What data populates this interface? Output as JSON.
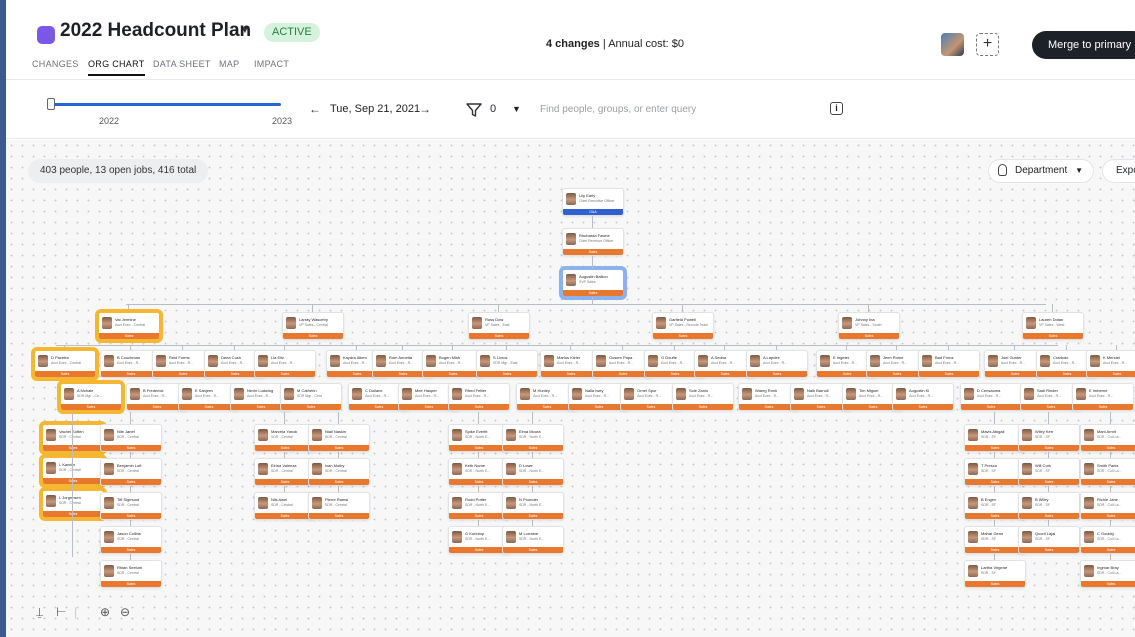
{
  "app": {
    "title": "2022 Headcount Plan",
    "status_badge": "ACTIVE",
    "changes_count": "4 changes",
    "annual_cost_label": "Annual cost: $0",
    "merge_label": "Merge to primary",
    "add_label": "+"
  },
  "tabs": [
    {
      "label": "CHANGES",
      "active": false
    },
    {
      "label": "ORG CHART",
      "active": true
    },
    {
      "label": "DATA SHEET",
      "active": false
    },
    {
      "label": "MAP",
      "active": false
    },
    {
      "label": "IMPACT",
      "active": false
    }
  ],
  "timeline": {
    "start_label": "2022",
    "end_label": "2023",
    "position": 0
  },
  "date_nav": {
    "current_date": "Tue, Sep 21, 2021",
    "prev": "←",
    "next": "→"
  },
  "filter": {
    "count": "0"
  },
  "search": {
    "placeholder": "Find people, groups, or enter query"
  },
  "info_label": "i",
  "canvas": {
    "people_summary": "403 people, 13 open jobs, 416 total",
    "group_by": "Department",
    "export_label": "Expo"
  },
  "colors": {
    "accent": "#2a63d6",
    "sales_dept": "#e8782e",
    "gna_dept": "#2f5fd0",
    "highlight": "#f5b731",
    "selected": "#8ab2ec"
  },
  "org": {
    "root": [
      {
        "name": "Lily Early",
        "title": "Chief Executive Officer",
        "dept": "G&A",
        "style": "blue"
      },
      {
        "name": "Rhubarda Fawne",
        "title": "Chief Revenue Officer",
        "dept": "Sales",
        "style": ""
      },
      {
        "name": "Augustin Ballion",
        "title": "SVP Sales",
        "dept": "Sales",
        "style": "sel"
      }
    ],
    "vps": [
      {
        "name": "Val Jermine",
        "title": "Acct Exec - Central",
        "style": "hl"
      },
      {
        "name": "Larray Wascetry",
        "title": "VP Sales - Central",
        "style": ""
      },
      {
        "name": "Ross Dow",
        "title": "VP Sales - East",
        "style": ""
      },
      {
        "name": "Garfield Powell",
        "title": "VP Sales - Remote Team",
        "style": ""
      },
      {
        "name": "Johnny Ina",
        "title": "VP Sales - South",
        "style": ""
      },
      {
        "name": "Lauren Dotan",
        "title": "VP Sales - West",
        "style": ""
      }
    ],
    "level3": [
      {
        "name": "D Pacefra",
        "title": "Acct Exec - Central",
        "style": "hl"
      },
      {
        "name": "B Couchman",
        "title": "Acct Exec - R...",
        "style": ""
      },
      {
        "name": "Reid Forms",
        "title": "Acct Exec - R...",
        "style": ""
      },
      {
        "name": "Dena Cush",
        "title": "Acct Exec - R...",
        "style": ""
      },
      {
        "name": "Lia Ellz",
        "title": "Acct Exec - R...",
        "style": ""
      },
      {
        "name": "Kaydra Alben",
        "title": "Acct Exec - R...",
        "style": ""
      },
      {
        "name": "Rom Annetta",
        "title": "Acct Exec - R...",
        "style": ""
      },
      {
        "name": "Bogen Mish",
        "title": "Acct Exec - R...",
        "style": ""
      },
      {
        "name": "S Livros",
        "title": "SDR Mgr - East",
        "style": ""
      },
      {
        "name": "Marlus Kieler",
        "title": "Acct Exec - R...",
        "style": ""
      },
      {
        "name": "Gusem Papa",
        "title": "Acct Exec - R...",
        "style": ""
      },
      {
        "name": "G Doufte",
        "title": "Acct Exec - R...",
        "style": ""
      },
      {
        "name": "A Sedna",
        "title": "Acct Exec - R...",
        "style": ""
      },
      {
        "name": "A Lapoire",
        "title": "Acct Exec - R...",
        "style": ""
      },
      {
        "name": "E Ingeter",
        "title": "Acct Exec - R...",
        "style": ""
      },
      {
        "name": "Jeen Rome",
        "title": "Acct Exec - R...",
        "style": ""
      },
      {
        "name": "Bad Frons",
        "title": "Acct Exec - R...",
        "style": ""
      },
      {
        "name": "Joel Gunter",
        "title": "Acct Exec - R...",
        "style": ""
      },
      {
        "name": "Cradodo",
        "title": "Acct Exec - R...",
        "style": ""
      },
      {
        "name": "K Mendel",
        "title": "Acct Exec - R...",
        "style": ""
      },
      {
        "name": "C Madake",
        "title": "SDR Mgr - West",
        "style": ""
      },
      {
        "name": "C Lemaire",
        "title": "Acct Exec - R...",
        "style": ""
      }
    ],
    "level4": [
      {
        "name": "A Mchale",
        "title": "SDR Mgr - Ce...",
        "style": "hl"
      },
      {
        "name": "B Frederick",
        "title": "Acct Exec - R...",
        "style": ""
      },
      {
        "name": "E Sanjeev",
        "title": "Acct Exec - R...",
        "style": ""
      },
      {
        "name": "Nevin Ludwing",
        "title": "Acct Exec - R...",
        "style": ""
      },
      {
        "name": "M Catherin",
        "title": "SDR Mgr - Cent",
        "style": ""
      },
      {
        "name": "C Dullane",
        "title": "Acct Exec - R...",
        "style": ""
      },
      {
        "name": "Mee Hasper",
        "title": "Acct Exec - R...",
        "style": ""
      },
      {
        "name": "Rhed Fetter",
        "title": "Acct Exec - R...",
        "style": ""
      },
      {
        "name": "M Hunley",
        "title": "Acct Exec - R...",
        "style": ""
      },
      {
        "name": "Naila Iwey",
        "title": "Acct Exec - R...",
        "style": ""
      },
      {
        "name": "Ornet Spor",
        "title": "Acct Exec - R...",
        "style": ""
      },
      {
        "name": "Sole Zanlo",
        "title": "Acct Exec - R...",
        "style": ""
      },
      {
        "name": "Waerg Ronk",
        "title": "Acct Exec - R...",
        "style": ""
      },
      {
        "name": "Nalk Barnoll",
        "title": "Acct Exec - R...",
        "style": ""
      },
      {
        "name": "Tim Miguel",
        "title": "Acct Exec - R...",
        "style": ""
      },
      {
        "name": "Augustin Ki",
        "title": "Acct Exec - R...",
        "style": ""
      },
      {
        "name": "D Censaoma",
        "title": "Acct Exec - R...",
        "style": ""
      },
      {
        "name": "Sadi Rinder",
        "title": "Acct Exec - R...",
        "style": ""
      },
      {
        "name": "E Imberne",
        "title": "Acct Exec - R...",
        "style": ""
      },
      {
        "name": "P Sendoz",
        "title": "Acct Exec - R...",
        "style": ""
      }
    ],
    "left_column": [
      {
        "name": "Vachel Soften",
        "title": "SDR - Central",
        "style": "hl"
      },
      {
        "name": "L Kandor",
        "title": "SDR - Central",
        "style": "hl"
      },
      {
        "name": "L Jorgensen",
        "title": "SDR - Central",
        "style": "hl"
      }
    ],
    "sdr_a": [
      {
        "name": "Nile Janet",
        "title": "SDR - Central",
        "style": ""
      },
      {
        "name": "Benjamin Loft",
        "title": "SDR - Central",
        "style": ""
      },
      {
        "name": "Tiff Sigmund",
        "title": "SDR - Central",
        "style": ""
      },
      {
        "name": "Jason Collins",
        "title": "SDR - Central",
        "style": ""
      },
      {
        "name": "Rhian Seelum",
        "title": "SDR - Central",
        "style": ""
      }
    ],
    "sdr_b": [
      {
        "name": "Marcela Yanok",
        "title": "SDR - Central",
        "style": ""
      },
      {
        "name": "Elrina Valenza",
        "title": "SDR - Central",
        "style": ""
      },
      {
        "name": "Nils Awel",
        "title": "SDR - Central",
        "style": ""
      }
    ],
    "sdr_c": [
      {
        "name": "Niall Naskin",
        "title": "SDR - Central",
        "style": ""
      },
      {
        "name": "Ivan Molby",
        "title": "SDR - Central",
        "style": ""
      },
      {
        "name": "Pierre Ramsi",
        "title": "SDR - Central",
        "style": ""
      }
    ],
    "sdr_d": [
      {
        "name": "Spike Everitt",
        "title": "SDR - North E...",
        "style": ""
      },
      {
        "name": "Keth Nome",
        "title": "SDR - North E...",
        "style": ""
      },
      {
        "name": "Rodd Potter",
        "title": "SDR - North E...",
        "style": ""
      },
      {
        "name": "G Kurlotop",
        "title": "SDR - North E...",
        "style": ""
      }
    ],
    "sdr_e": [
      {
        "name": "Elma Moura",
        "title": "SDR - North E...",
        "style": ""
      },
      {
        "name": "D Lowe",
        "title": "SDR - North E...",
        "style": ""
      },
      {
        "name": "N Pounder",
        "title": "SDR - North E...",
        "style": ""
      },
      {
        "name": "M Lorraine",
        "title": "SDR - North E...",
        "style": ""
      }
    ],
    "sdr_f": [
      {
        "name": "Mavis Abigail",
        "title": "SDR - SF",
        "style": ""
      },
      {
        "name": "T Prescu",
        "title": "SDR - SF",
        "style": ""
      },
      {
        "name": "B Engen",
        "title": "SDR - SF",
        "style": ""
      },
      {
        "name": "Mahar Genn",
        "title": "SDR - SF",
        "style": ""
      },
      {
        "name": "Lartha Virgene",
        "title": "SDR - SF",
        "style": ""
      }
    ],
    "sdr_g": [
      {
        "name": "Wiley Kerr",
        "title": "SDR - SF",
        "style": ""
      },
      {
        "name": "Will Cork",
        "title": "SDR - SF",
        "style": ""
      },
      {
        "name": "B Wiley",
        "title": "SDR - SF",
        "style": ""
      },
      {
        "name": "Quoril Lajai",
        "title": "SDR - SF",
        "style": ""
      }
    ],
    "sdr_h": [
      {
        "name": "Mani Armit",
        "title": "SDR - Coll La...",
        "style": ""
      },
      {
        "name": "Smith Parks",
        "title": "SDR - Coll La...",
        "style": ""
      },
      {
        "name": "Richie Jane",
        "title": "SDR - Coll La...",
        "style": ""
      },
      {
        "name": "C Goddry",
        "title": "SDR - Coll La...",
        "style": ""
      },
      {
        "name": "Ingmar Bray",
        "title": "SDR - Coll La...",
        "style": ""
      }
    ]
  }
}
